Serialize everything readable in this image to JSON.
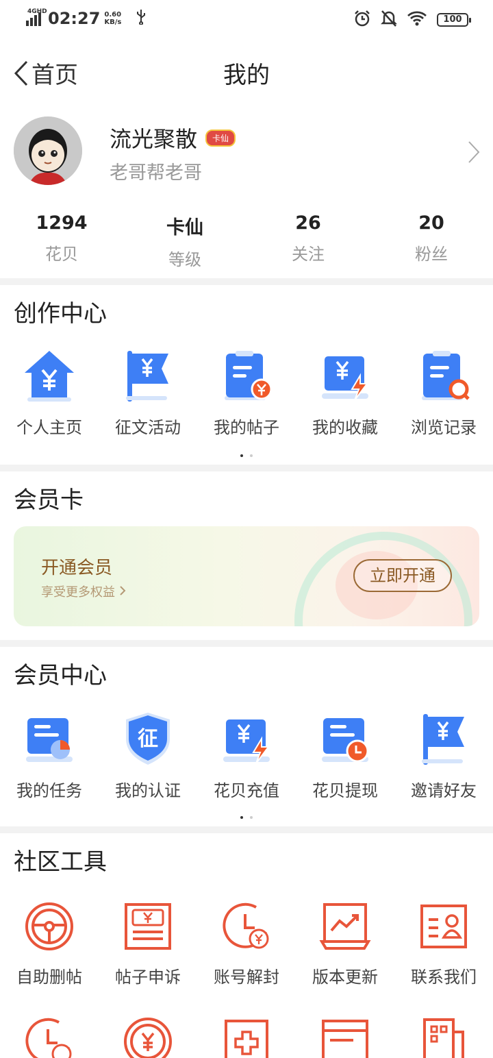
{
  "status_bar": {
    "network": "4GHD",
    "time": "02:27",
    "speed_value": "0.60",
    "speed_unit": "KB/s",
    "battery": "100"
  },
  "nav": {
    "back_label": "首页",
    "title": "我的"
  },
  "profile": {
    "name": "流光聚散",
    "badge": "卡仙",
    "subtitle": "老哥帮老哥"
  },
  "stats": [
    {
      "value": "1294",
      "label": "花贝"
    },
    {
      "value": "卡仙",
      "label": "等级"
    },
    {
      "value": "26",
      "label": "关注"
    },
    {
      "value": "20",
      "label": "粉丝"
    }
  ],
  "creation_center": {
    "title": "创作中心",
    "items": [
      {
        "label": "个人主页",
        "icon": "home-yuan-icon"
      },
      {
        "label": "征文活动",
        "icon": "flag-yuan-icon"
      },
      {
        "label": "我的帖子",
        "icon": "post-icon"
      },
      {
        "label": "我的收藏",
        "icon": "favorite-icon"
      },
      {
        "label": "浏览记录",
        "icon": "history-icon"
      }
    ]
  },
  "member_card": {
    "title": "会员卡",
    "card_title": "开通会员",
    "card_sub": "享受更多权益",
    "button": "立即开通"
  },
  "member_center": {
    "title": "会员中心",
    "items": [
      {
        "label": "我的任务",
        "icon": "task-icon"
      },
      {
        "label": "我的认证",
        "icon": "verify-shield-icon"
      },
      {
        "label": "花贝充值",
        "icon": "recharge-icon"
      },
      {
        "label": "花贝提现",
        "icon": "withdraw-icon"
      },
      {
        "label": "邀请好友",
        "icon": "invite-flag-icon"
      }
    ]
  },
  "community_tools": {
    "title": "社区工具",
    "items": [
      {
        "label": "自助删帖",
        "icon": "steering-wheel-icon"
      },
      {
        "label": "帖子申诉",
        "icon": "appeal-bill-icon"
      },
      {
        "label": "账号解封",
        "icon": "clock-yuan-icon"
      },
      {
        "label": "版本更新",
        "icon": "update-chart-icon"
      },
      {
        "label": "联系我们",
        "icon": "contact-card-icon"
      }
    ],
    "row2_icons": [
      "clock-yuan-icon",
      "coin-yuan-icon",
      "medical-plus-icon",
      "card-icon",
      "building-icon"
    ]
  },
  "colors": {
    "accent_blue": "#3e7ff5",
    "light_blue": "#d5e4fb",
    "accent_orange": "#f05a2a",
    "tool_red": "#e8553a"
  }
}
